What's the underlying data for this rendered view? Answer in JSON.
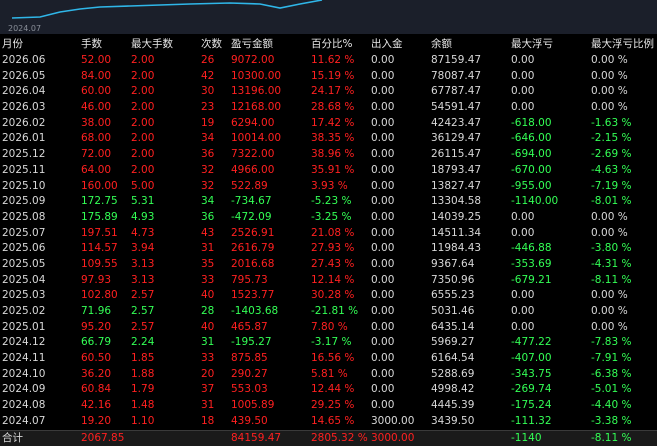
{
  "chart": {
    "date_label": "2024.07",
    "line_color": "#2fb6e8"
  },
  "headers": [
    "月份",
    "手数",
    "最大手数",
    "次数",
    "盈亏金额",
    "百分比%",
    "出入金",
    "余额",
    "最大浮亏",
    "最大浮亏比例"
  ],
  "rows": [
    {
      "month": "2026.06",
      "lots": "52.00",
      "max_lots": "2.00",
      "count": "26",
      "pnl": "9072.00",
      "pct": "11.62 %",
      "flow": "0.00",
      "balance": "87159.47",
      "max_dd": "0.00",
      "max_dd_pct": "0.00 %",
      "side": "red"
    },
    {
      "month": "2026.05",
      "lots": "84.00",
      "max_lots": "2.00",
      "count": "42",
      "pnl": "10300.00",
      "pct": "15.19 %",
      "flow": "0.00",
      "balance": "78087.47",
      "max_dd": "0.00",
      "max_dd_pct": "0.00 %",
      "side": "red"
    },
    {
      "month": "2026.04",
      "lots": "60.00",
      "max_lots": "2.00",
      "count": "30",
      "pnl": "13196.00",
      "pct": "24.17 %",
      "flow": "0.00",
      "balance": "67787.47",
      "max_dd": "0.00",
      "max_dd_pct": "0.00 %",
      "side": "red"
    },
    {
      "month": "2026.03",
      "lots": "46.00",
      "max_lots": "2.00",
      "count": "23",
      "pnl": "12168.00",
      "pct": "28.68 %",
      "flow": "0.00",
      "balance": "54591.47",
      "max_dd": "0.00",
      "max_dd_pct": "0.00 %",
      "side": "red"
    },
    {
      "month": "2026.02",
      "lots": "38.00",
      "max_lots": "2.00",
      "count": "19",
      "pnl": "6294.00",
      "pct": "17.42 %",
      "flow": "0.00",
      "balance": "42423.47",
      "max_dd": "-618.00",
      "max_dd_pct": "-1.63 %",
      "side": "red"
    },
    {
      "month": "2026.01",
      "lots": "68.00",
      "max_lots": "2.00",
      "count": "34",
      "pnl": "10014.00",
      "pct": "38.35 %",
      "flow": "0.00",
      "balance": "36129.47",
      "max_dd": "-646.00",
      "max_dd_pct": "-2.15 %",
      "side": "red"
    },
    {
      "month": "2025.12",
      "lots": "72.00",
      "max_lots": "2.00",
      "count": "36",
      "pnl": "7322.00",
      "pct": "38.96 %",
      "flow": "0.00",
      "balance": "26115.47",
      "max_dd": "-694.00",
      "max_dd_pct": "-2.69 %",
      "side": "red"
    },
    {
      "month": "2025.11",
      "lots": "64.00",
      "max_lots": "2.00",
      "count": "32",
      "pnl": "4966.00",
      "pct": "35.91 %",
      "flow": "0.00",
      "balance": "18793.47",
      "max_dd": "-670.00",
      "max_dd_pct": "-4.63 %",
      "side": "red"
    },
    {
      "month": "2025.10",
      "lots": "160.00",
      "max_lots": "5.00",
      "count": "32",
      "pnl": "522.89",
      "pct": "3.93 %",
      "flow": "0.00",
      "balance": "13827.47",
      "max_dd": "-955.00",
      "max_dd_pct": "-7.19 %",
      "side": "red"
    },
    {
      "month": "2025.09",
      "lots": "172.75",
      "max_lots": "5.31",
      "count": "34",
      "pnl": "-734.67",
      "pct": "-5.23 %",
      "flow": "0.00",
      "balance": "13304.58",
      "max_dd": "-1140.00",
      "max_dd_pct": "-8.01 %",
      "side": "green"
    },
    {
      "month": "2025.08",
      "lots": "175.89",
      "max_lots": "4.93",
      "count": "36",
      "pnl": "-472.09",
      "pct": "-3.25 %",
      "flow": "0.00",
      "balance": "14039.25",
      "max_dd": "0.00",
      "max_dd_pct": "0.00 %",
      "side": "green"
    },
    {
      "month": "2025.07",
      "lots": "197.51",
      "max_lots": "4.73",
      "count": "43",
      "pnl": "2526.91",
      "pct": "21.08 %",
      "flow": "0.00",
      "balance": "14511.34",
      "max_dd": "0.00",
      "max_dd_pct": "0.00 %",
      "side": "red"
    },
    {
      "month": "2025.06",
      "lots": "114.57",
      "max_lots": "3.94",
      "count": "31",
      "pnl": "2616.79",
      "pct": "27.93 %",
      "flow": "0.00",
      "balance": "11984.43",
      "max_dd": "-446.88",
      "max_dd_pct": "-3.80 %",
      "side": "red"
    },
    {
      "month": "2025.05",
      "lots": "109.55",
      "max_lots": "3.13",
      "count": "35",
      "pnl": "2016.68",
      "pct": "27.43 %",
      "flow": "0.00",
      "balance": "9367.64",
      "max_dd": "-353.69",
      "max_dd_pct": "-4.31 %",
      "side": "red"
    },
    {
      "month": "2025.04",
      "lots": "97.93",
      "max_lots": "3.13",
      "count": "33",
      "pnl": "795.73",
      "pct": "12.14 %",
      "flow": "0.00",
      "balance": "7350.96",
      "max_dd": "-679.21",
      "max_dd_pct": "-8.11 %",
      "side": "red"
    },
    {
      "month": "2025.03",
      "lots": "102.80",
      "max_lots": "2.57",
      "count": "40",
      "pnl": "1523.77",
      "pct": "30.28 %",
      "flow": "0.00",
      "balance": "6555.23",
      "max_dd": "0.00",
      "max_dd_pct": "0.00 %",
      "side": "red"
    },
    {
      "month": "2025.02",
      "lots": "71.96",
      "max_lots": "2.57",
      "count": "28",
      "pnl": "-1403.68",
      "pct": "-21.81 %",
      "flow": "0.00",
      "balance": "5031.46",
      "max_dd": "0.00",
      "max_dd_pct": "0.00 %",
      "side": "green"
    },
    {
      "month": "2025.01",
      "lots": "95.20",
      "max_lots": "2.57",
      "count": "40",
      "pnl": "465.87",
      "pct": "7.80 %",
      "flow": "0.00",
      "balance": "6435.14",
      "max_dd": "0.00",
      "max_dd_pct": "0.00 %",
      "side": "red"
    },
    {
      "month": "2024.12",
      "lots": "66.79",
      "max_lots": "2.24",
      "count": "31",
      "pnl": "-195.27",
      "pct": "-3.17 %",
      "flow": "0.00",
      "balance": "5969.27",
      "max_dd": "-477.22",
      "max_dd_pct": "-7.83 %",
      "side": "green"
    },
    {
      "month": "2024.11",
      "lots": "60.50",
      "max_lots": "1.85",
      "count": "33",
      "pnl": "875.85",
      "pct": "16.56 %",
      "flow": "0.00",
      "balance": "6164.54",
      "max_dd": "-407.00",
      "max_dd_pct": "-7.91 %",
      "side": "red"
    },
    {
      "month": "2024.10",
      "lots": "36.20",
      "max_lots": "1.88",
      "count": "20",
      "pnl": "290.27",
      "pct": "5.81 %",
      "flow": "0.00",
      "balance": "5288.69",
      "max_dd": "-343.75",
      "max_dd_pct": "-6.38 %",
      "side": "red"
    },
    {
      "month": "2024.09",
      "lots": "60.84",
      "max_lots": "1.79",
      "count": "37",
      "pnl": "553.03",
      "pct": "12.44 %",
      "flow": "0.00",
      "balance": "4998.42",
      "max_dd": "-269.74",
      "max_dd_pct": "-5.01 %",
      "side": "red"
    },
    {
      "month": "2024.08",
      "lots": "42.16",
      "max_lots": "1.48",
      "count": "31",
      "pnl": "1005.89",
      "pct": "29.25 %",
      "flow": "0.00",
      "balance": "4445.39",
      "max_dd": "-175.24",
      "max_dd_pct": "-4.40 %",
      "side": "red"
    },
    {
      "month": "2024.07",
      "lots": "19.20",
      "max_lots": "1.10",
      "count": "18",
      "pnl": "439.50",
      "pct": "14.65 %",
      "flow": "3000.00",
      "balance": "3439.50",
      "max_dd": "-111.32",
      "max_dd_pct": "-3.38 %",
      "side": "red"
    }
  ],
  "total": {
    "month": "合计",
    "lots": "2067.85",
    "max_lots": "",
    "count": "",
    "pnl": "84159.47",
    "pct": "2805.32 %",
    "flow": "3000.00",
    "balance": "",
    "max_dd": "-1140",
    "max_dd_pct": "-8.11 %"
  },
  "colors": {
    "profit": "#ff2020",
    "loss": "#33ff55",
    "neutral": "#d8d8d8"
  }
}
